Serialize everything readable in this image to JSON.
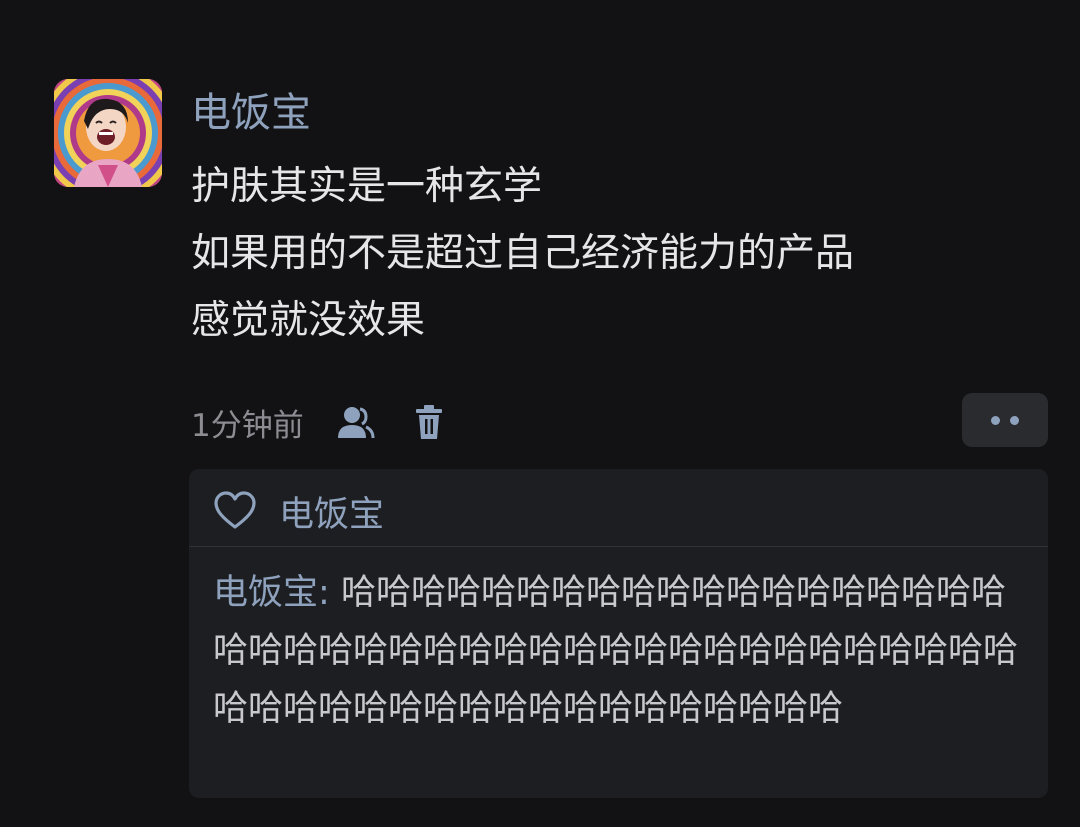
{
  "post": {
    "username": "电饭宝",
    "content_lines": [
      "护肤其实是一种玄学",
      "如果用的不是超过自己经济能力的产品",
      "感觉就没效果"
    ],
    "time": "1分钟前",
    "icons": {
      "user": "user-icon",
      "delete": "trash-icon",
      "more": "more-dots-icon"
    }
  },
  "replies": {
    "like_icon": "heart-icon",
    "liked_by": "电饭宝",
    "items": [
      {
        "author": "电饭宝",
        "separator": ":",
        "text": " 哈哈哈哈哈哈哈哈哈哈哈哈哈哈哈哈哈哈哈哈哈哈哈哈哈哈哈哈哈哈哈哈哈哈哈哈哈哈哈哈哈哈哈哈哈哈哈哈哈哈哈哈哈哈哈哈哈哈哈哈"
      }
    ]
  },
  "colors": {
    "background": "#121214",
    "accent": "#8fa2bd",
    "text": "#e6e6e8",
    "muted": "#8c8c92",
    "reply_box": "#1d1e21"
  }
}
